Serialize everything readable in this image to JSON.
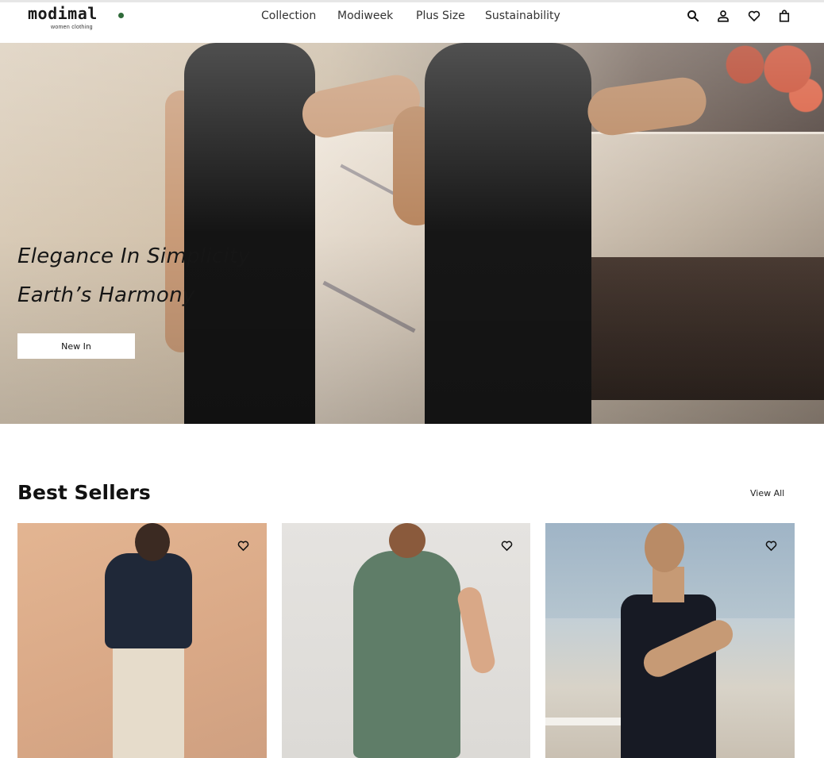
{
  "brand": {
    "name": "modimal",
    "tagline": "women clothing"
  },
  "nav": {
    "items": [
      "Collection",
      "Modiweek",
      "Plus Size",
      "Sustainability"
    ]
  },
  "header_icons": [
    "search-icon",
    "user-icon",
    "heart-icon",
    "bag-icon"
  ],
  "hero": {
    "line1": "Elegance In Simplicity",
    "line2": "Earth’s Harmony",
    "button_label": "New In"
  },
  "best_sellers": {
    "title": "Best Sellers",
    "view_all_label": "View All",
    "products": [
      {
        "image": "model-navy-sweater-beige-pants",
        "favorite_icon": "heart-outline-icon"
      },
      {
        "image": "model-green-wrap-dress",
        "favorite_icon": "heart-outline-icon"
      },
      {
        "image": "model-black-square-neck-dress",
        "favorite_icon": "heart-outline-icon"
      }
    ]
  },
  "colors": {
    "text": "#111111",
    "logo_accent": "#2f6b3a",
    "button_bg": "#ffffff"
  }
}
